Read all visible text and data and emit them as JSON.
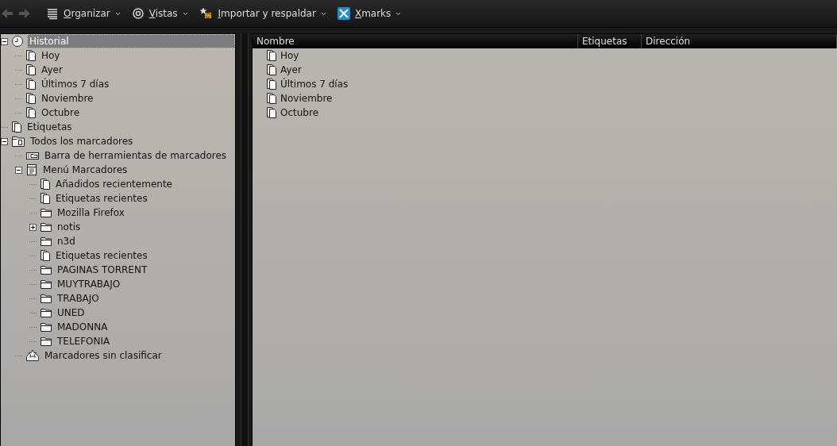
{
  "toolbar": {
    "menus": [
      {
        "label": "Organizar"
      },
      {
        "label": "Vistas"
      },
      {
        "label": "Importar y respaldar"
      },
      {
        "label": "Xmarks"
      }
    ]
  },
  "sidebar": {
    "tree": [
      {
        "label": "Historial",
        "kind": "history",
        "selected": true,
        "expanded": true,
        "children": [
          {
            "label": "Hoy",
            "kind": "query",
            "selected": false
          },
          {
            "label": "Ayer",
            "kind": "query",
            "selected": false
          },
          {
            "label": "Últimos 7 días",
            "kind": "query",
            "selected": false
          },
          {
            "label": "Noviembre",
            "kind": "query",
            "selected": false
          },
          {
            "label": "Octubre",
            "kind": "query",
            "selected": false
          }
        ]
      },
      {
        "label": "Etiquetas",
        "kind": "query",
        "selected": false
      },
      {
        "label": "Todos los marcadores",
        "kind": "library",
        "selected": false,
        "expanded": true,
        "children": [
          {
            "label": "Barra de herramientas de marcadores",
            "kind": "toolbar",
            "selected": false
          },
          {
            "label": "Menú Marcadores",
            "kind": "menu",
            "selected": false,
            "expanded": true,
            "children": [
              {
                "label": "Añadidos recientemente",
                "kind": "query",
                "selected": false
              },
              {
                "label": "Etiquetas recientes",
                "kind": "query",
                "selected": false
              },
              {
                "label": "Mozilla Firefox",
                "kind": "folder",
                "selected": false
              },
              {
                "label": "notis",
                "kind": "folder",
                "selected": false,
                "expanded": false
              },
              {
                "label": "n3d",
                "kind": "folder",
                "selected": false
              },
              {
                "label": "Etiquetas recientes",
                "kind": "query",
                "selected": false
              },
              {
                "label": "PAGINAS TORRENT",
                "kind": "folder",
                "selected": false
              },
              {
                "label": "MUYTRABAJO",
                "kind": "folder",
                "selected": false
              },
              {
                "label": "TRABAJO",
                "kind": "folder",
                "selected": false
              },
              {
                "label": "UNED",
                "kind": "folder",
                "selected": false
              },
              {
                "label": "MADONNA",
                "kind": "folder",
                "selected": false
              },
              {
                "label": "TELEFONIA",
                "kind": "folder",
                "selected": false
              }
            ]
          },
          {
            "label": "Marcadores sin clasificar",
            "kind": "unsorted",
            "selected": false
          }
        ]
      }
    ]
  },
  "table": {
    "columns": [
      "Nombre",
      "Etiquetas",
      "Dirección"
    ],
    "rows": [
      {
        "name": "Hoy",
        "kind": "query"
      },
      {
        "name": "Ayer",
        "kind": "query"
      },
      {
        "name": "Últimos 7 días",
        "kind": "query"
      },
      {
        "name": "Noviembre",
        "kind": "query"
      },
      {
        "name": "Octubre",
        "kind": "query"
      }
    ]
  }
}
